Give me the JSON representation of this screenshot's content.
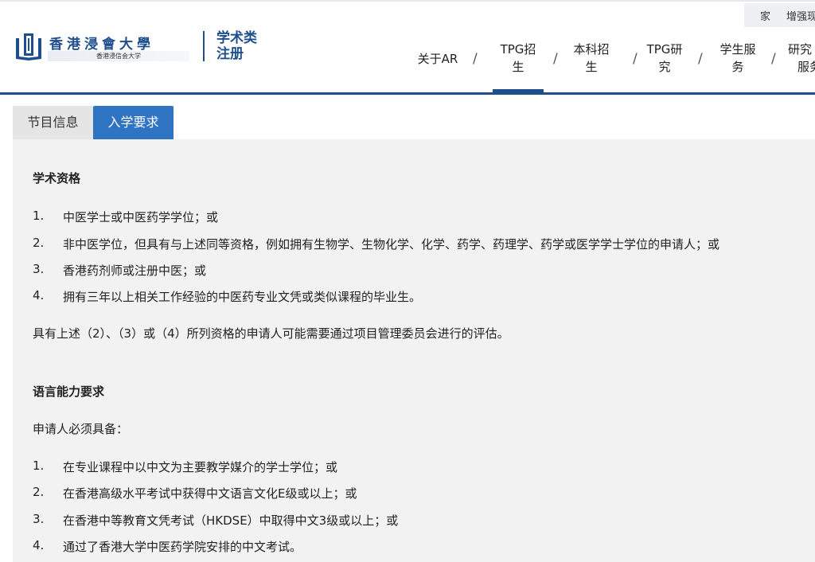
{
  "utility": {
    "items": [
      "家",
      "增强现"
    ]
  },
  "logo": {
    "name": "香港浸會大學",
    "subtitle": "香港浸信会大学"
  },
  "site_title": {
    "line1": "学术类",
    "line2": "注册"
  },
  "nav": {
    "items": [
      {
        "line1": "关于AR",
        "line2": ""
      },
      {
        "line1": "TPG招",
        "line2": "生"
      },
      {
        "line1": "本科招",
        "line2": "生"
      },
      {
        "line1": "TPG研",
        "line2": "究"
      },
      {
        "line1": "学生服",
        "line2": "务"
      },
      {
        "line1": "研究",
        "line2": "服务"
      }
    ],
    "separator": "/",
    "active_index": 1
  },
  "tabs": [
    "节目信息",
    "入学要求"
  ],
  "colors": {
    "brand": "#1f4e8c",
    "tab_active": "#2f73c3",
    "panel": "#f2f2f2"
  },
  "academic": {
    "heading": "学术资格",
    "items": [
      {
        "num": "1.",
        "text": "中医学士或中医药学学位；或"
      },
      {
        "num": "2.",
        "text": "非中医学位，但具有与上述同等资格，例如拥有生物学、生物化学、化学、药学、药理学、药学或医学学士学位的申请人；或"
      },
      {
        "num": "3.",
        "text": "香港药剂师或注册中医；或"
      },
      {
        "num": "4.",
        "text": "拥有三年以上相关工作经验的中医药专业文凭或类似课程的毕业生。"
      }
    ],
    "note": "具有上述（2）、（3）或（4）所列资格的申请人可能需要通过项目管理委员会进行的评估。"
  },
  "language": {
    "heading": "语言能力要求",
    "intro": "申请人必须具备：",
    "items": [
      {
        "num": "1.",
        "text": "在专业课程中以中文为主要教学媒介的学士学位；或"
      },
      {
        "num": "2.",
        "text": "在香港高级水平考试中获得中文语言文化E级或以上；或"
      },
      {
        "num": "3.",
        "text": "在香港中等教育文凭考试（HKDSE）中取得中文3级或以上；或"
      },
      {
        "num": "4.",
        "text": "通过了香港大学中医药学院安排的中文考试。"
      }
    ]
  }
}
